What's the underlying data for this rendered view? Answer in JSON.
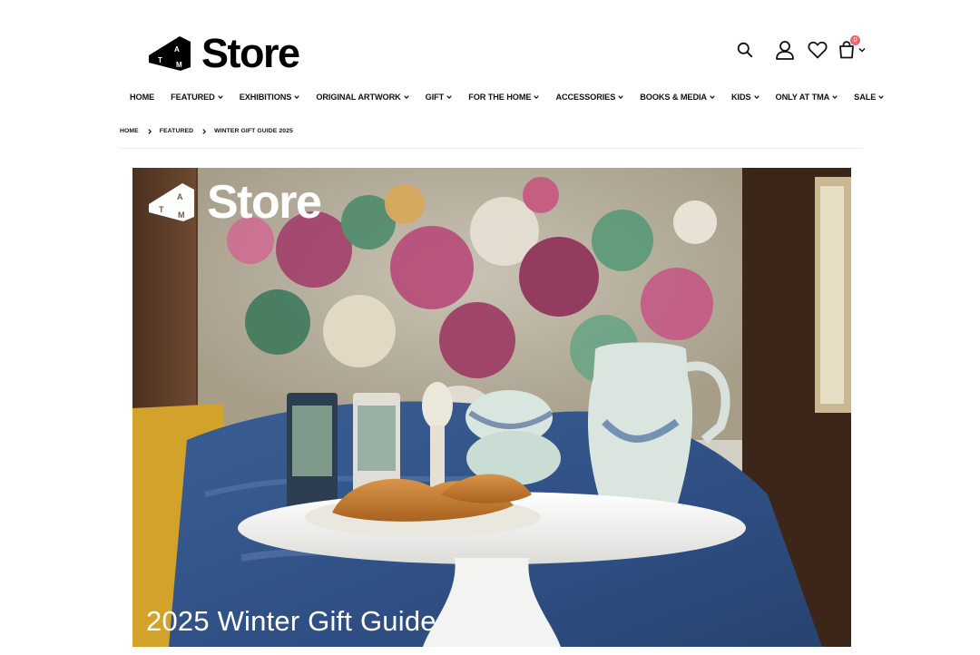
{
  "brand": {
    "logo_letters": "TMA",
    "name": "Store"
  },
  "header": {
    "icons": [
      "search-icon",
      "user-icon",
      "heart-icon",
      "bag-icon",
      "chevron-down-icon"
    ],
    "cart_count": "0",
    "accent_color": "#e36b6b"
  },
  "nav": {
    "items": [
      {
        "label": "HOME",
        "has_dropdown": false
      },
      {
        "label": "FEATURED",
        "has_dropdown": true
      },
      {
        "label": "EXHIBITIONS",
        "has_dropdown": true
      },
      {
        "label": "ORIGINAL ARTWORK",
        "has_dropdown": true
      },
      {
        "label": "GIFT",
        "has_dropdown": true
      },
      {
        "label": "FOR THE HOME",
        "has_dropdown": true
      },
      {
        "label": "ACCESSORIES",
        "has_dropdown": true
      },
      {
        "label": "BOOKS & MEDIA",
        "has_dropdown": true
      },
      {
        "label": "KIDS",
        "has_dropdown": true
      },
      {
        "label": "ONLY AT TMA",
        "has_dropdown": true
      },
      {
        "label": "SALE",
        "has_dropdown": true
      }
    ]
  },
  "breadcrumb": {
    "items": [
      "HOME",
      "FEATURED",
      "WINTER GIFT GUIDE 2025"
    ]
  },
  "hero": {
    "logo_name": "Store",
    "caption": "2025 Winter Gift Guide"
  }
}
